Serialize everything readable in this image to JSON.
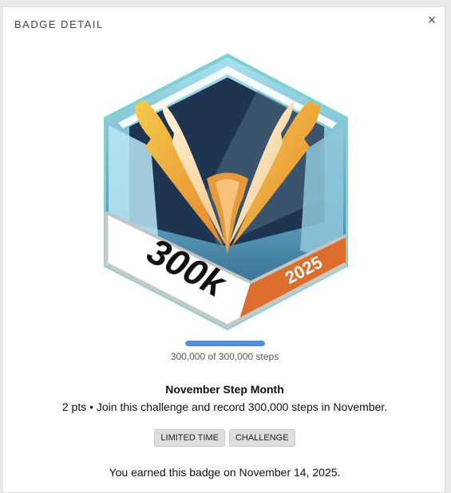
{
  "modal": {
    "title": "BADGE DETAIL",
    "close_label": "×"
  },
  "badge": {
    "number_text": "300k",
    "year_text": "2025",
    "icon": "hexagon-steps-badge",
    "colors": {
      "outline": "#7dd3d1",
      "dark": "#1e3350",
      "blue": "#4f8fb0",
      "orange": "#dd6d2c",
      "gold": "#f2c544"
    }
  },
  "progress": {
    "fraction": 1.0,
    "text": "300,000 of 300,000 steps",
    "color": "#4f8ee6"
  },
  "info": {
    "name": "November Step Month",
    "description": "2 pts • Join this challenge and record 300,000 steps in November."
  },
  "tags": [
    {
      "label": "LIMITED TIME"
    },
    {
      "label": "CHALLENGE"
    }
  ],
  "earned": "You earned this badge on November 14, 2025."
}
